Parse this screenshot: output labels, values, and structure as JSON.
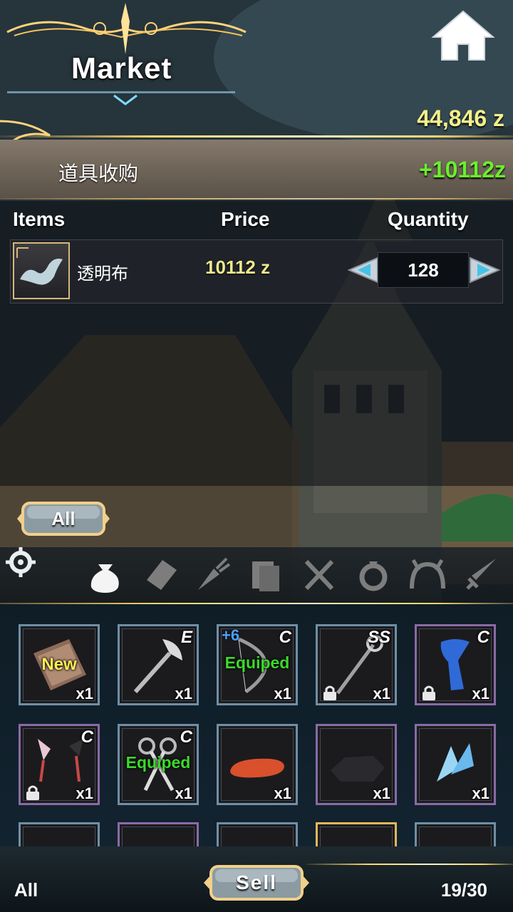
{
  "header": {
    "title": "Market",
    "money": "44,846 z"
  },
  "order": {
    "name": "道具收购",
    "gain": "+10112z"
  },
  "table": {
    "columns": [
      "Items",
      "Price",
      "Quantity"
    ],
    "row": {
      "name": "透明布",
      "price": "10112 z",
      "quantity": "128"
    }
  },
  "filter": {
    "all_label": "All"
  },
  "categories": [
    "bag-icon",
    "card-icon",
    "carrot-icon",
    "books-icon",
    "utensils-icon",
    "ring-icon",
    "headband-icon",
    "sword-icon"
  ],
  "inventory": {
    "slots": [
      {
        "grade": "",
        "count": "x1",
        "tag": "New",
        "art": "book"
      },
      {
        "grade": "E",
        "count": "x1",
        "tag": "",
        "art": "axe"
      },
      {
        "grade": "C",
        "count": "x1",
        "tag": "Equiped",
        "plus": "+6",
        "art": "bow"
      },
      {
        "grade": "SS",
        "count": "x1",
        "tag": "",
        "art": "staff",
        "locked": true
      },
      {
        "grade": "C",
        "count": "x1",
        "tag": "",
        "art": "scarf",
        "locked": true
      },
      {
        "grade": "C",
        "count": "x1",
        "tag": "",
        "art": "earrings",
        "locked": true
      },
      {
        "grade": "C",
        "count": "x1",
        "tag": "Equiped",
        "art": "scissors"
      },
      {
        "grade": "",
        "count": "x1",
        "tag": "",
        "art": "sausage"
      },
      {
        "grade": "",
        "count": "x1",
        "tag": "",
        "art": "rock"
      },
      {
        "grade": "",
        "count": "x1",
        "tag": "",
        "art": "crystal"
      }
    ]
  },
  "footer": {
    "filter_label": "All",
    "sell_label": "Sell",
    "capacity": "19/30"
  }
}
